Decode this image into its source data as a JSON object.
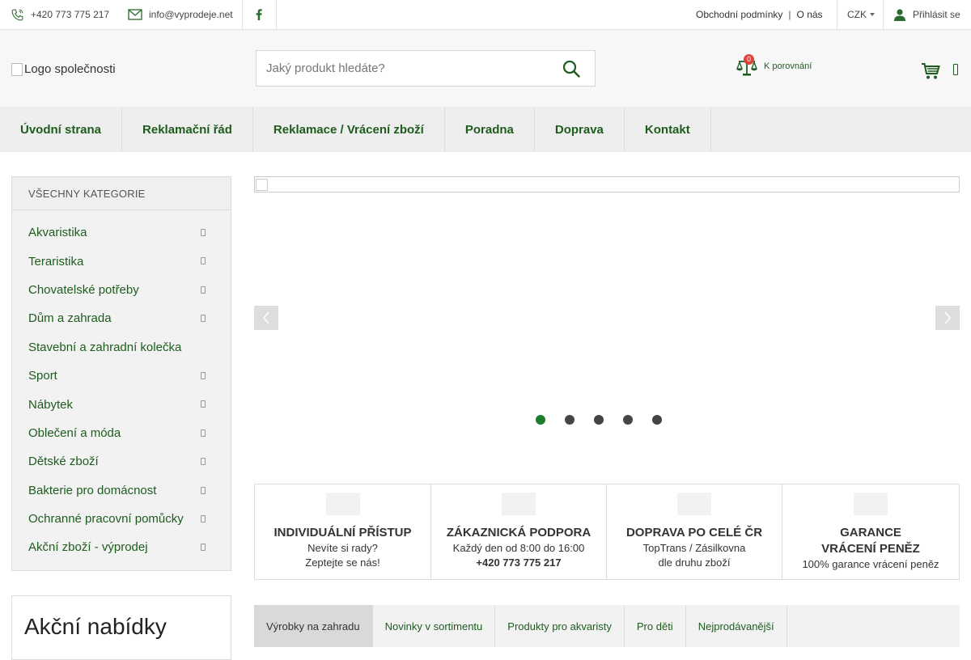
{
  "topbar": {
    "phone": "+420 773 775 217",
    "email": "info@vyprodeje.net",
    "links": [
      "Obchodní podmínky",
      "O nás"
    ],
    "currency": "CZK",
    "login": "Přihlásit se"
  },
  "header": {
    "logo_alt": "Logo společnosti",
    "search_placeholder": "Jaký produkt hledáte?",
    "compare_count": "0",
    "compare_label": "K porovnání"
  },
  "nav": {
    "items": [
      "Úvodní strana",
      "Reklamační řád",
      "Reklamace / Vrácení zboží",
      "Poradna",
      "Doprava",
      "Kontakt"
    ]
  },
  "sidebar": {
    "title": "VŠECHNY KATEGORIE",
    "categories": [
      {
        "label": "Akvaristika",
        "has_sub": true
      },
      {
        "label": "Teraristika",
        "has_sub": true
      },
      {
        "label": "Chovatelské potřeby",
        "has_sub": true
      },
      {
        "label": "Dům a zahrada",
        "has_sub": true
      },
      {
        "label": "Stavební a zahradní kolečka",
        "has_sub": false
      },
      {
        "label": "Sport",
        "has_sub": true
      },
      {
        "label": "Nábytek",
        "has_sub": true
      },
      {
        "label": "Oblečení a móda",
        "has_sub": true
      },
      {
        "label": "Dětské zboží",
        "has_sub": true
      },
      {
        "label": "Bakterie pro domácnost",
        "has_sub": true
      },
      {
        "label": "Ochranné pracovní pomůcky",
        "has_sub": true
      },
      {
        "label": "Akční zboží - výprodej",
        "has_sub": true
      }
    ],
    "promo_title": "Akční nabídky"
  },
  "slider": {
    "slide_count": 5,
    "active_slide": 1
  },
  "benefits": [
    {
      "title": "INDIVIDUÁLNÍ PŘÍSTUP",
      "line1": "Nevíte si rady?",
      "line2": "Zeptejte se nás!",
      "line2_bold": false
    },
    {
      "title": "ZÁKAZNICKÁ PODPORA",
      "line1": "Každý den od 8:00 do 16:00",
      "line2": "+420 773 775 217",
      "line2_bold": true
    },
    {
      "title": "DOPRAVA PO CELÉ ČR",
      "line1": "TopTrans / Zásilkovna",
      "line2": "dle druhu zboží",
      "line2_bold": false
    },
    {
      "title": "GARANCE VRÁCENÍ PENĚZ",
      "line1": "100% garance vrácení peněz",
      "line2": "",
      "line2_bold": false
    }
  ],
  "tabs": [
    "Výrobky na zahradu",
    "Novinky v sortimentu",
    "Produkty pro akvaristy",
    "Pro děti",
    "Nejprodávanější"
  ],
  "colors": {
    "brand_green": "#1e5c1e",
    "active_dot": "#1d7d2c",
    "badge_red": "#e0433b"
  }
}
